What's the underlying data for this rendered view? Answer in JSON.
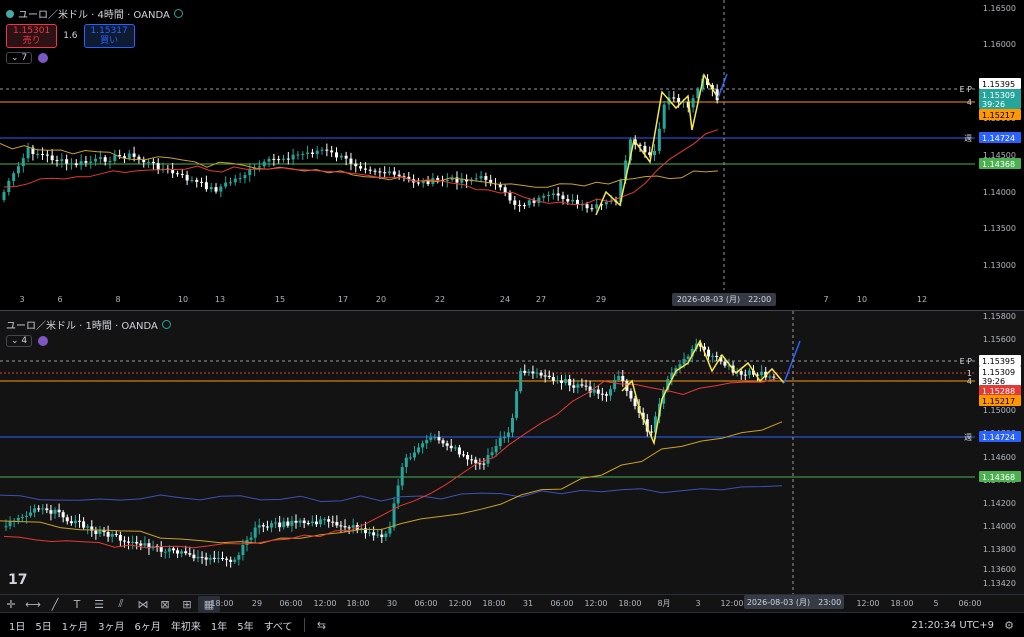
{
  "pane1": {
    "title": "ユーロ／米ドル · 4時間 · OANDA",
    "sell_price": "1.15301",
    "sell_label": "売り",
    "spread": "1.6",
    "buy_price": "1.15317",
    "buy_label": "買い",
    "indicator_count": "7",
    "price_ticks": [
      "1.16500",
      "1.16000",
      "1.15500",
      "1.15000",
      "1.14500",
      "1.14000",
      "1.13500",
      "1.13000"
    ],
    "price_labels": {
      "ep": "1.15395",
      "last": "1.15309",
      "countdown": "39:26",
      "line4": "1.15217",
      "weekly": "1.14724",
      "green": "1.14368"
    },
    "line_tags": {
      "ep": "E P",
      "four": "4",
      "week": "週"
    },
    "date_ticks": [
      "3",
      "6",
      "8",
      "10",
      "13",
      "15",
      "17",
      "20",
      "22",
      "24",
      "27",
      "29",
      "7",
      "10",
      "12"
    ],
    "crosshair_label": "2026-08-03 (月)　22:00"
  },
  "pane2": {
    "title": "ユーロ／米ドル · 1時間 · OANDA",
    "indicator_count": "4",
    "price_ticks": [
      "1.15800",
      "1.15600",
      "1.15400",
      "1.15200",
      "1.15000",
      "1.14800",
      "1.14600",
      "1.14400",
      "1.14200",
      "1.14000",
      "1.13800",
      "1.13600",
      "1.13420"
    ],
    "price_labels": {
      "ep": "1.15395",
      "last": "1.15309",
      "countdown": "39:26",
      "red": "1.15288",
      "line4": "1.15217",
      "weekly": "1.14724",
      "green": "1.14368"
    },
    "line_tags": {
      "ep": "E P",
      "one": "1",
      "four": "4",
      "week": "週"
    },
    "time_ticks": [
      "18:00",
      "29",
      "06:00",
      "12:00",
      "18:00",
      "30",
      "06:00",
      "12:00",
      "18:00",
      "31",
      "06:00",
      "12:00",
      "18:00",
      "8月",
      "3",
      "12:00",
      "12:00",
      "18:00",
      "5",
      "06:00"
    ],
    "crosshair_label": "2026-08-03 (月)　23:00"
  },
  "bottombar": {
    "timeframes": [
      "1日",
      "5日",
      "1ヶ月",
      "3ヶ月",
      "6ヶ月",
      "年初来",
      "1年",
      "5年",
      "すべて"
    ],
    "clock": "21:20:34 UTC+9"
  },
  "logo": "17",
  "colors": {
    "up": "#26a69a",
    "down": "#ffffff",
    "ma_red": "#e53935",
    "ma_yellow": "#c9a227",
    "zigzag": "#f5e94a",
    "blue_line": "#2962ff",
    "green_line": "#4caf50",
    "orange_line": "#ff9800"
  }
}
